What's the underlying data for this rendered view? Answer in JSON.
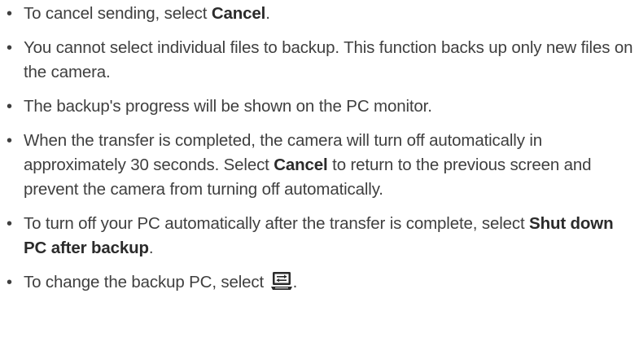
{
  "bullet": "•",
  "items": [
    {
      "before": "To cancel sending, select ",
      "bold": "Cancel",
      "after": "."
    },
    {
      "text": "You cannot select individual files to backup. This function backs up only new files on the camera."
    },
    {
      "text": "The backup's progress will be shown on the PC monitor."
    },
    {
      "before": "When the transfer is completed, the camera will turn off automatically in approximately 30 seconds. Select ",
      "bold": "Cancel",
      "after": " to return to the previous screen and prevent the camera from turning off automatically."
    },
    {
      "before": "To turn off your PC automatically after the transfer is complete, select ",
      "bold": "Shut down PC after backup",
      "after": "."
    },
    {
      "before": "To change the backup PC, select ",
      "icon": "computer-monitor-icon",
      "after": "."
    }
  ]
}
